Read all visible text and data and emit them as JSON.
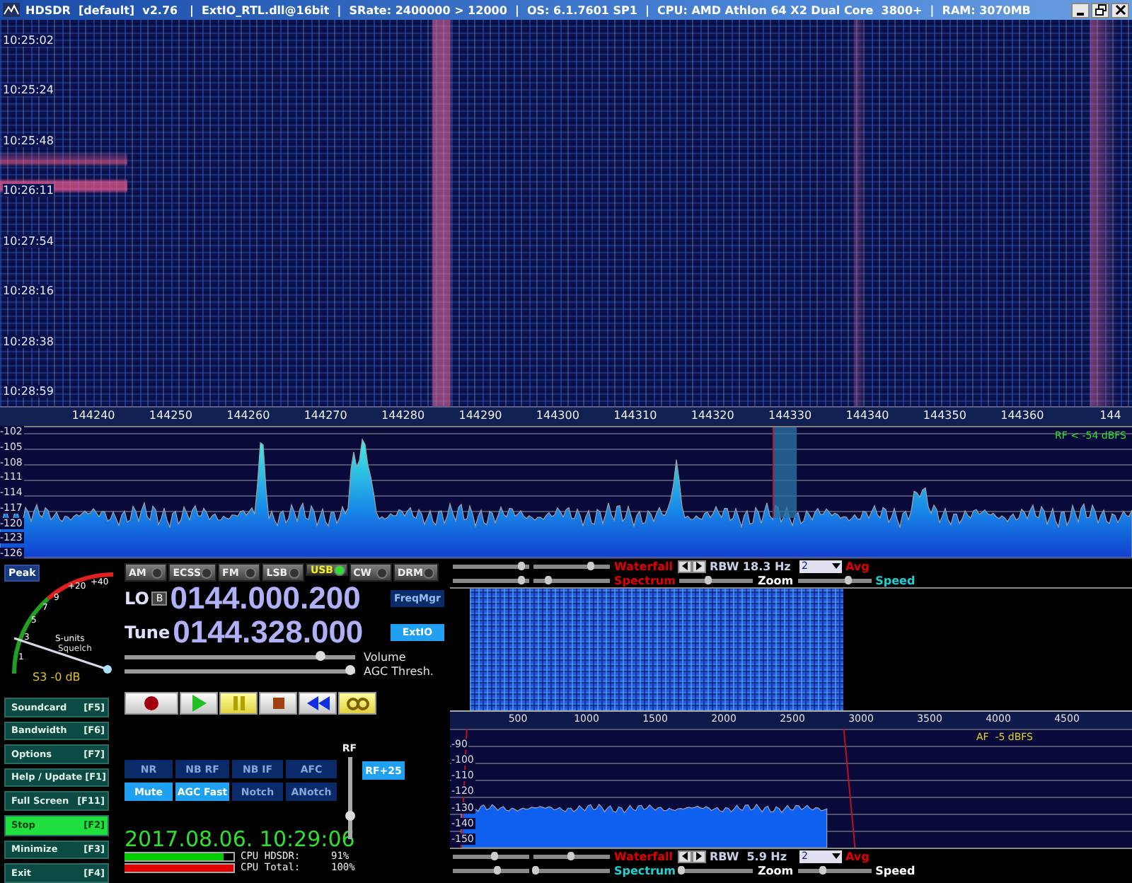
{
  "window": {
    "title": "HDSDR  [default]  v2.76   |  ExtIO_RTL.dll@16bit  |  SRate: 2400000 > 12000  |  OS: 6.1.7601 SP1  |  CPU: AMD Athlon 64 X2 Dual Core  3800+  |  RAM: 3070MB"
  },
  "waterfall": {
    "timestamps": [
      "10:25:02",
      "10:25:24",
      "10:25:48",
      "10:26:11",
      "10:27:54",
      "10:28:16",
      "10:28:38",
      "10:28:59"
    ]
  },
  "frequency_axis": {
    "labels": [
      "144240",
      "144250",
      "144260",
      "144270",
      "144280",
      "144290",
      "144300",
      "144310",
      "144320",
      "144330",
      "144340",
      "144350",
      "144360",
      "144"
    ]
  },
  "spectrum": {
    "y_labels": [
      "-102",
      "-105",
      "-108",
      "-111",
      "-114",
      "-117",
      "-120",
      "-123",
      "-126"
    ],
    "readout": "RF < -54 dBFS"
  },
  "smeter": {
    "peak_button": "Peak",
    "scale": [
      "1",
      "3",
      "5",
      "7",
      "9",
      "+20",
      "+40"
    ],
    "units_label": "S-units",
    "squelch_label": "Squelch",
    "reading": "S3 -0 dB"
  },
  "function_buttons": [
    {
      "label": "Soundcard",
      "key": "[F5]",
      "active": false
    },
    {
      "label": "Bandwidth",
      "key": "[F6]",
      "active": false
    },
    {
      "label": "Options",
      "key": "[F7]",
      "active": false
    },
    {
      "label": "Help / Update",
      "key": "[F1]",
      "active": false
    },
    {
      "label": "Full Screen",
      "key": "[F11]",
      "active": false
    },
    {
      "label": "Stop",
      "key": "[F2]",
      "active": true
    },
    {
      "label": "Minimize",
      "key": "[F3]",
      "active": false
    },
    {
      "label": "Exit",
      "key": "[F4]",
      "active": false
    }
  ],
  "modes": [
    {
      "label": "AM",
      "selected": false
    },
    {
      "label": "ECSS",
      "selected": false
    },
    {
      "label": "FM",
      "selected": false
    },
    {
      "label": "LSB",
      "selected": false
    },
    {
      "label": "USB",
      "selected": true
    },
    {
      "label": "CW",
      "selected": false
    },
    {
      "label": "DRM",
      "selected": false
    }
  ],
  "lo": {
    "label": "LO",
    "bank": "B",
    "value": "0144.000.200"
  },
  "tune": {
    "label": "Tune",
    "value": "0144.328.000"
  },
  "freqmgr_button": {
    "label": "FreqMgr",
    "on": false
  },
  "extio_button": {
    "label": "ExtIO",
    "on": true
  },
  "sliders": [
    {
      "label": "Volume",
      "level": 0.85
    },
    {
      "label": "AGC Thresh.",
      "level": 0.98
    }
  ],
  "transport": [
    {
      "kind": "record"
    },
    {
      "kind": "play"
    },
    {
      "kind": "pause"
    },
    {
      "kind": "stop"
    },
    {
      "kind": "rewind"
    },
    {
      "kind": "loop"
    }
  ],
  "dsp_buttons": [
    {
      "label": "NR",
      "on": false
    },
    {
      "label": "NB RF",
      "on": false
    },
    {
      "label": "NB IF",
      "on": false
    },
    {
      "label": "AFC",
      "on": false
    },
    {
      "label": "Mute",
      "on": true
    },
    {
      "label": "AGC Fast",
      "on": true
    },
    {
      "label": "Notch",
      "on": false
    },
    {
      "label": "ANotch",
      "on": false
    }
  ],
  "rf": {
    "label": "RF",
    "level": 0.3,
    "button": {
      "label": "RF+25",
      "on": true
    }
  },
  "clock": "2017.08.06. 10:29:06",
  "cpu": [
    {
      "label": "CPU HDSDR:",
      "reading": "91%",
      "level": 0.91,
      "color": "#00cc00"
    },
    {
      "label": "CPU Total:",
      "reading": "100%",
      "level": 1,
      "color": "#e00000"
    }
  ],
  "audio": {
    "top_controls": {
      "sliders": [
        {
          "level": 0.9
        },
        {
          "level": 0.75
        },
        {
          "level": 0.9
        },
        {
          "level": 0.2
        },
        {
          "level": 0.4
        },
        {
          "level": 0.7
        }
      ],
      "rbw": "RBW 18.3 Hz",
      "avg_value": "2",
      "labels": [
        {
          "text": "Waterfall",
          "color": "#e00000"
        },
        {
          "text": "Avg",
          "color": "#e00000"
        },
        {
          "text": "Spectrum",
          "color": "#e00000"
        },
        {
          "text": "Zoom",
          "color": "#ffffff"
        },
        {
          "text": "Speed",
          "color": "#20d0d0"
        }
      ]
    },
    "axis": [
      "500",
      "1000",
      "1500",
      "2000",
      "2500",
      "3000",
      "3500",
      "4000",
      "4500"
    ],
    "y_labels": [
      "-90",
      "-100",
      "-110",
      "-120",
      "-130",
      "-140",
      "-150"
    ],
    "readout": "AF  -5 dBFS",
    "bottom_controls": {
      "sliders": [
        {
          "level": 0.55
        },
        {
          "level": 0.5
        },
        {
          "level": 0.6
        },
        {
          "level": 0.03
        },
        {
          "level": 0.02
        },
        {
          "level": 0.35
        }
      ],
      "rbw": "RBW  5.9 Hz",
      "avg_value": "2",
      "labels": [
        {
          "text": "Waterfall",
          "color": "#e00000"
        },
        {
          "text": "Avg",
          "color": "#e00000"
        },
        {
          "text": "Spectrum",
          "color": "#20d0d0"
        },
        {
          "text": "Zoom",
          "color": "#ffffff"
        },
        {
          "text": "Speed",
          "color": "#ffffff"
        }
      ]
    }
  }
}
